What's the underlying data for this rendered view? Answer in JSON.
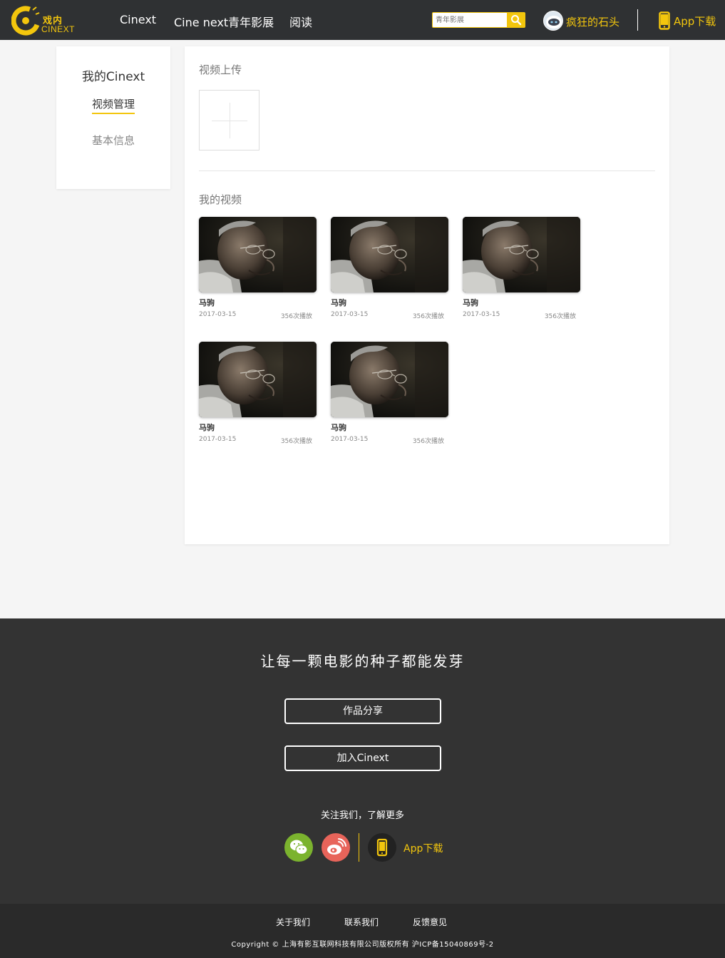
{
  "header": {
    "logo": {
      "cn": "戏内",
      "en": "CINEXT"
    },
    "nav": [
      {
        "label": "Cinext"
      },
      {
        "label": "Cine next青年影展"
      },
      {
        "label": "阅读"
      }
    ],
    "search": {
      "placeholder": "青年影展",
      "icon": "search-icon"
    },
    "user": {
      "name": "疯狂的石头",
      "avatar_icon": "robot-avatar"
    },
    "app_download": {
      "label": "App下载",
      "icon": "phone-icon"
    }
  },
  "sidebar": {
    "title": "我的Cinext",
    "items": [
      {
        "label": "视频管理",
        "active": true
      },
      {
        "label": "基本信息",
        "active": false
      }
    ]
  },
  "main": {
    "upload_title": "视频上传",
    "upload_icon": "plus-icon",
    "videos_title": "我的视频",
    "videos": [
      {
        "title": "马驹",
        "date": "2017-03-15",
        "plays": "356次播放"
      },
      {
        "title": "马驹",
        "date": "2017-03-15",
        "plays": "356次播放"
      },
      {
        "title": "马驹",
        "date": "2017-03-15",
        "plays": "356次播放"
      },
      {
        "title": "马驹",
        "date": "2017-03-15",
        "plays": "356次播放"
      },
      {
        "title": "马驹",
        "date": "2017-03-15",
        "plays": "356次播放"
      }
    ]
  },
  "footer": {
    "slogan": "让每一颗电影的种子都能发芽",
    "buttons": [
      {
        "label": "作品分享"
      },
      {
        "label": "加入Cinext"
      }
    ],
    "follow_text": "关注我们，了解更多",
    "social": [
      {
        "icon": "wechat-icon",
        "color": "#7bb32e"
      },
      {
        "icon": "weibo-icon",
        "color": "#e8645a"
      }
    ],
    "app_download": {
      "label": "App下载",
      "icon": "phone-icon"
    },
    "links": [
      {
        "label": "关于我们"
      },
      {
        "label": "联系我们"
      },
      {
        "label": "反馈意见"
      }
    ],
    "copyright": "Copyright © 上海有影互联网科技有限公司版权所有 沪ICP备15040869号-2"
  },
  "colors": {
    "accent": "#f3c60d",
    "header_bg": "#2f3133",
    "footer_bg": "#333333"
  }
}
